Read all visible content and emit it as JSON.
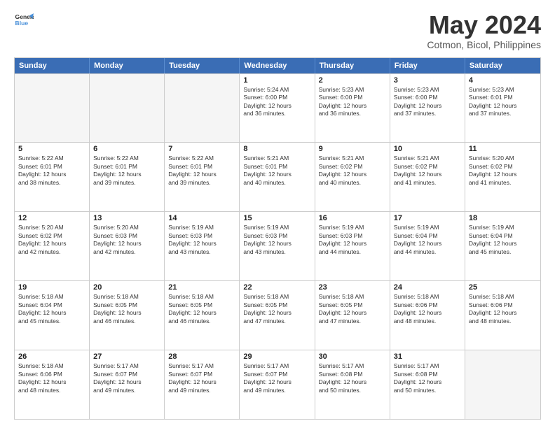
{
  "logo": {
    "line1": "General",
    "line2": "Blue"
  },
  "title": "May 2024",
  "subtitle": "Cotmon, Bicol, Philippines",
  "header_days": [
    "Sunday",
    "Monday",
    "Tuesday",
    "Wednesday",
    "Thursday",
    "Friday",
    "Saturday"
  ],
  "weeks": [
    [
      {
        "day": "",
        "info": "",
        "empty": true
      },
      {
        "day": "",
        "info": "",
        "empty": true
      },
      {
        "day": "",
        "info": "",
        "empty": true
      },
      {
        "day": "1",
        "info": "Sunrise: 5:24 AM\nSunset: 6:00 PM\nDaylight: 12 hours\nand 36 minutes.",
        "empty": false
      },
      {
        "day": "2",
        "info": "Sunrise: 5:23 AM\nSunset: 6:00 PM\nDaylight: 12 hours\nand 36 minutes.",
        "empty": false
      },
      {
        "day": "3",
        "info": "Sunrise: 5:23 AM\nSunset: 6:00 PM\nDaylight: 12 hours\nand 37 minutes.",
        "empty": false
      },
      {
        "day": "4",
        "info": "Sunrise: 5:23 AM\nSunset: 6:01 PM\nDaylight: 12 hours\nand 37 minutes.",
        "empty": false
      }
    ],
    [
      {
        "day": "5",
        "info": "Sunrise: 5:22 AM\nSunset: 6:01 PM\nDaylight: 12 hours\nand 38 minutes.",
        "empty": false
      },
      {
        "day": "6",
        "info": "Sunrise: 5:22 AM\nSunset: 6:01 PM\nDaylight: 12 hours\nand 39 minutes.",
        "empty": false
      },
      {
        "day": "7",
        "info": "Sunrise: 5:22 AM\nSunset: 6:01 PM\nDaylight: 12 hours\nand 39 minutes.",
        "empty": false
      },
      {
        "day": "8",
        "info": "Sunrise: 5:21 AM\nSunset: 6:01 PM\nDaylight: 12 hours\nand 40 minutes.",
        "empty": false
      },
      {
        "day": "9",
        "info": "Sunrise: 5:21 AM\nSunset: 6:02 PM\nDaylight: 12 hours\nand 40 minutes.",
        "empty": false
      },
      {
        "day": "10",
        "info": "Sunrise: 5:21 AM\nSunset: 6:02 PM\nDaylight: 12 hours\nand 41 minutes.",
        "empty": false
      },
      {
        "day": "11",
        "info": "Sunrise: 5:20 AM\nSunset: 6:02 PM\nDaylight: 12 hours\nand 41 minutes.",
        "empty": false
      }
    ],
    [
      {
        "day": "12",
        "info": "Sunrise: 5:20 AM\nSunset: 6:02 PM\nDaylight: 12 hours\nand 42 minutes.",
        "empty": false
      },
      {
        "day": "13",
        "info": "Sunrise: 5:20 AM\nSunset: 6:03 PM\nDaylight: 12 hours\nand 42 minutes.",
        "empty": false
      },
      {
        "day": "14",
        "info": "Sunrise: 5:19 AM\nSunset: 6:03 PM\nDaylight: 12 hours\nand 43 minutes.",
        "empty": false
      },
      {
        "day": "15",
        "info": "Sunrise: 5:19 AM\nSunset: 6:03 PM\nDaylight: 12 hours\nand 43 minutes.",
        "empty": false
      },
      {
        "day": "16",
        "info": "Sunrise: 5:19 AM\nSunset: 6:03 PM\nDaylight: 12 hours\nand 44 minutes.",
        "empty": false
      },
      {
        "day": "17",
        "info": "Sunrise: 5:19 AM\nSunset: 6:04 PM\nDaylight: 12 hours\nand 44 minutes.",
        "empty": false
      },
      {
        "day": "18",
        "info": "Sunrise: 5:19 AM\nSunset: 6:04 PM\nDaylight: 12 hours\nand 45 minutes.",
        "empty": false
      }
    ],
    [
      {
        "day": "19",
        "info": "Sunrise: 5:18 AM\nSunset: 6:04 PM\nDaylight: 12 hours\nand 45 minutes.",
        "empty": false
      },
      {
        "day": "20",
        "info": "Sunrise: 5:18 AM\nSunset: 6:05 PM\nDaylight: 12 hours\nand 46 minutes.",
        "empty": false
      },
      {
        "day": "21",
        "info": "Sunrise: 5:18 AM\nSunset: 6:05 PM\nDaylight: 12 hours\nand 46 minutes.",
        "empty": false
      },
      {
        "day": "22",
        "info": "Sunrise: 5:18 AM\nSunset: 6:05 PM\nDaylight: 12 hours\nand 47 minutes.",
        "empty": false
      },
      {
        "day": "23",
        "info": "Sunrise: 5:18 AM\nSunset: 6:05 PM\nDaylight: 12 hours\nand 47 minutes.",
        "empty": false
      },
      {
        "day": "24",
        "info": "Sunrise: 5:18 AM\nSunset: 6:06 PM\nDaylight: 12 hours\nand 48 minutes.",
        "empty": false
      },
      {
        "day": "25",
        "info": "Sunrise: 5:18 AM\nSunset: 6:06 PM\nDaylight: 12 hours\nand 48 minutes.",
        "empty": false
      }
    ],
    [
      {
        "day": "26",
        "info": "Sunrise: 5:18 AM\nSunset: 6:06 PM\nDaylight: 12 hours\nand 48 minutes.",
        "empty": false
      },
      {
        "day": "27",
        "info": "Sunrise: 5:17 AM\nSunset: 6:07 PM\nDaylight: 12 hours\nand 49 minutes.",
        "empty": false
      },
      {
        "day": "28",
        "info": "Sunrise: 5:17 AM\nSunset: 6:07 PM\nDaylight: 12 hours\nand 49 minutes.",
        "empty": false
      },
      {
        "day": "29",
        "info": "Sunrise: 5:17 AM\nSunset: 6:07 PM\nDaylight: 12 hours\nand 49 minutes.",
        "empty": false
      },
      {
        "day": "30",
        "info": "Sunrise: 5:17 AM\nSunset: 6:08 PM\nDaylight: 12 hours\nand 50 minutes.",
        "empty": false
      },
      {
        "day": "31",
        "info": "Sunrise: 5:17 AM\nSunset: 6:08 PM\nDaylight: 12 hours\nand 50 minutes.",
        "empty": false
      },
      {
        "day": "",
        "info": "",
        "empty": true
      }
    ]
  ]
}
